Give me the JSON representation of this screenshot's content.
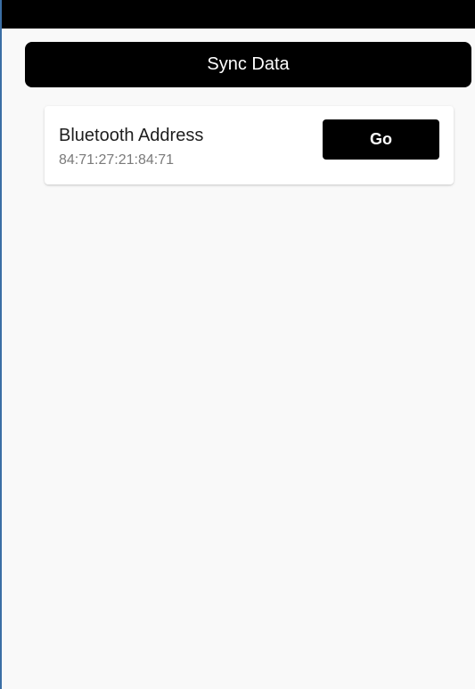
{
  "header": {
    "sync_label": "Sync Data"
  },
  "devices": [
    {
      "name": "Bluetooth Address",
      "address": "84:71:27:21:84:71",
      "action_label": "Go"
    }
  ],
  "colors": {
    "status_bar": "#000000",
    "primary_button": "#000000",
    "background": "#f9f9f9",
    "card": "#ffffff",
    "secondary_text": "#7a7a7a"
  }
}
